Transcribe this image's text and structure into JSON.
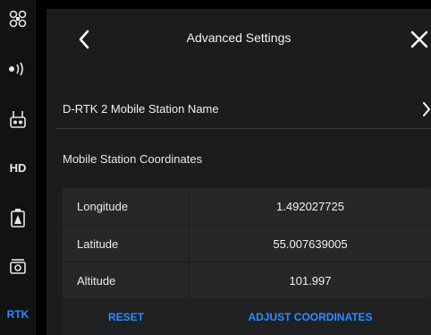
{
  "sidebar": {
    "items": [
      {
        "icon": "drone-icon",
        "label": ""
      },
      {
        "icon": "signal-broadcast-icon",
        "label": ""
      },
      {
        "icon": "remote-controller-icon",
        "label": ""
      },
      {
        "icon": "hd-icon",
        "label": "HD"
      },
      {
        "icon": "battery-icon",
        "label": ""
      },
      {
        "icon": "camera-icon",
        "label": ""
      },
      {
        "icon": "rtk-icon",
        "label": "RTK"
      }
    ],
    "active_color": "#2d8cff"
  },
  "header": {
    "title": "Advanced Settings"
  },
  "station_name_row": {
    "label": "D-RTK 2 Mobile Station Name"
  },
  "coordinates": {
    "title": "Mobile Station Coordinates",
    "rows": [
      {
        "label": "Longitude",
        "value": "1.492027725"
      },
      {
        "label": "Latitude",
        "value": "55.007639005"
      },
      {
        "label": "Altitude",
        "value": "101.997"
      }
    ]
  },
  "actions": {
    "reset_label": "RESET",
    "adjust_label": "ADJUST COORDINATES"
  },
  "colors": {
    "accent": "#2d8cff",
    "panel_bg": "#1b1c1e",
    "table_bg": "#262729"
  }
}
